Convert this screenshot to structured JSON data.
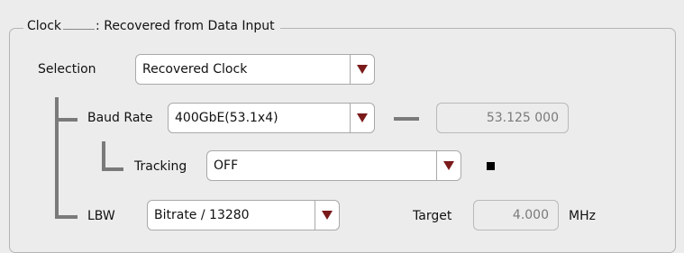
{
  "group": {
    "title": "Clock",
    "subtitle": ": Recovered from Data Input"
  },
  "selection": {
    "label": "Selection",
    "value": "Recovered Clock"
  },
  "baud_rate": {
    "label": "Baud Rate",
    "value": "400GbE(53.1x4)",
    "readout": "53.125 000"
  },
  "tracking": {
    "label": "Tracking",
    "value": "OFF"
  },
  "lbw": {
    "label": "LBW",
    "value": "Bitrate / 13280",
    "target_label": "Target",
    "target_value": "4.000",
    "unit": "MHz"
  },
  "colors": {
    "arrow": "#7a1a1a",
    "connector": "#7a7a7a",
    "background": "#ececec"
  },
  "icons": {
    "dropdown": "triangle-down-icon",
    "indicator": "square-indicator-icon"
  }
}
